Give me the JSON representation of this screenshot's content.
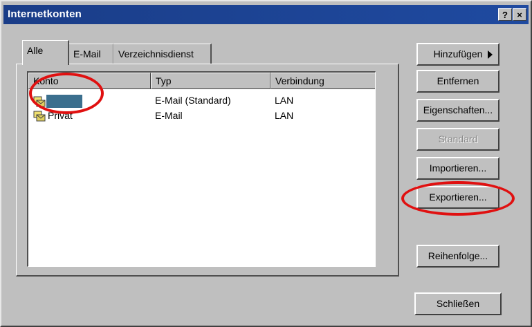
{
  "window": {
    "title": "Internetkonten",
    "help_label": "?",
    "close_label": "×"
  },
  "tabs": [
    {
      "label": "Alle",
      "active": true
    },
    {
      "label": "E-Mail",
      "active": false
    },
    {
      "label": "Verzeichnisdienst",
      "active": false
    }
  ],
  "list": {
    "columns": [
      "Konto",
      "Typ",
      "Verbindung"
    ],
    "rows": [
      {
        "konto": "",
        "typ": "E-Mail (Standard)",
        "verbindung": "LAN",
        "selected": true,
        "icon": "mail-account-icon"
      },
      {
        "konto": "Privat",
        "typ": "E-Mail",
        "verbindung": "LAN",
        "selected": false,
        "icon": "mail-account-icon"
      }
    ]
  },
  "buttons": {
    "add": "Hinzufügen",
    "remove": "Entfernen",
    "properties": "Eigenschaften...",
    "default": "Standard",
    "import": "Importieren...",
    "export": "Exportieren...",
    "order": "Reihenfolge...",
    "close": "Schließen"
  },
  "colors": {
    "titlebar": "#1f4aa0",
    "dialog": "#bfbfbf",
    "selection": "#3b6f8e",
    "highlight_circle": "#e01010"
  }
}
